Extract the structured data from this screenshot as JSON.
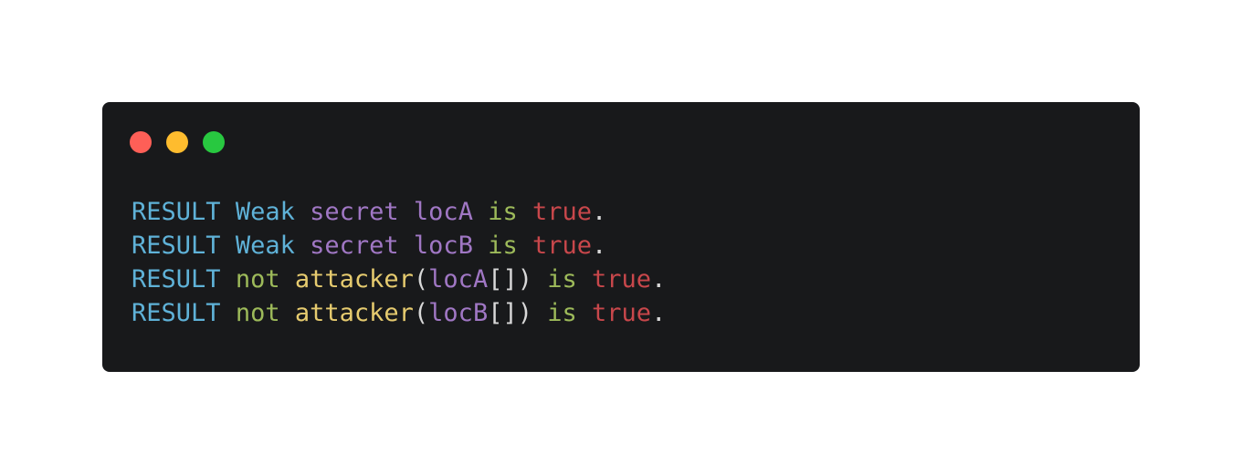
{
  "window": {
    "controls": [
      {
        "name": "close",
        "color": "#fe5f57"
      },
      {
        "name": "minimize",
        "color": "#febc2e"
      },
      {
        "name": "maximize",
        "color": "#28c840"
      }
    ]
  },
  "colors": {
    "keyword": "#5fb2d8",
    "purple": "#a077c4",
    "green": "#9dba5a",
    "red": "#c8474b",
    "yellow": "#e6cb6f",
    "plain": "#d8d8d8"
  },
  "code": {
    "lines": [
      [
        {
          "text": "RESULT",
          "kind": "keyword"
        },
        {
          "text": " ",
          "kind": "plain"
        },
        {
          "text": "Weak",
          "kind": "keyword"
        },
        {
          "text": " ",
          "kind": "plain"
        },
        {
          "text": "secret",
          "kind": "purple"
        },
        {
          "text": " ",
          "kind": "plain"
        },
        {
          "text": "locA",
          "kind": "purple"
        },
        {
          "text": " ",
          "kind": "plain"
        },
        {
          "text": "is",
          "kind": "green"
        },
        {
          "text": " ",
          "kind": "plain"
        },
        {
          "text": "true",
          "kind": "red"
        },
        {
          "text": ".",
          "kind": "plain"
        }
      ],
      [
        {
          "text": "RESULT",
          "kind": "keyword"
        },
        {
          "text": " ",
          "kind": "plain"
        },
        {
          "text": "Weak",
          "kind": "keyword"
        },
        {
          "text": " ",
          "kind": "plain"
        },
        {
          "text": "secret",
          "kind": "purple"
        },
        {
          "text": " ",
          "kind": "plain"
        },
        {
          "text": "locB",
          "kind": "purple"
        },
        {
          "text": " ",
          "kind": "plain"
        },
        {
          "text": "is",
          "kind": "green"
        },
        {
          "text": " ",
          "kind": "plain"
        },
        {
          "text": "true",
          "kind": "red"
        },
        {
          "text": ".",
          "kind": "plain"
        }
      ],
      [
        {
          "text": "RESULT",
          "kind": "keyword"
        },
        {
          "text": " ",
          "kind": "plain"
        },
        {
          "text": "not",
          "kind": "green"
        },
        {
          "text": " ",
          "kind": "plain"
        },
        {
          "text": "attacker",
          "kind": "yellow"
        },
        {
          "text": "(",
          "kind": "plain"
        },
        {
          "text": "locA",
          "kind": "purple"
        },
        {
          "text": "[])",
          "kind": "plain"
        },
        {
          "text": " ",
          "kind": "plain"
        },
        {
          "text": "is",
          "kind": "green"
        },
        {
          "text": " ",
          "kind": "plain"
        },
        {
          "text": "true",
          "kind": "red"
        },
        {
          "text": ".",
          "kind": "plain"
        }
      ],
      [
        {
          "text": "RESULT",
          "kind": "keyword"
        },
        {
          "text": " ",
          "kind": "plain"
        },
        {
          "text": "not",
          "kind": "green"
        },
        {
          "text": " ",
          "kind": "plain"
        },
        {
          "text": "attacker",
          "kind": "yellow"
        },
        {
          "text": "(",
          "kind": "plain"
        },
        {
          "text": "locB",
          "kind": "purple"
        },
        {
          "text": "[])",
          "kind": "plain"
        },
        {
          "text": " ",
          "kind": "plain"
        },
        {
          "text": "is",
          "kind": "green"
        },
        {
          "text": " ",
          "kind": "plain"
        },
        {
          "text": "true",
          "kind": "red"
        },
        {
          "text": ".",
          "kind": "plain"
        }
      ]
    ]
  }
}
